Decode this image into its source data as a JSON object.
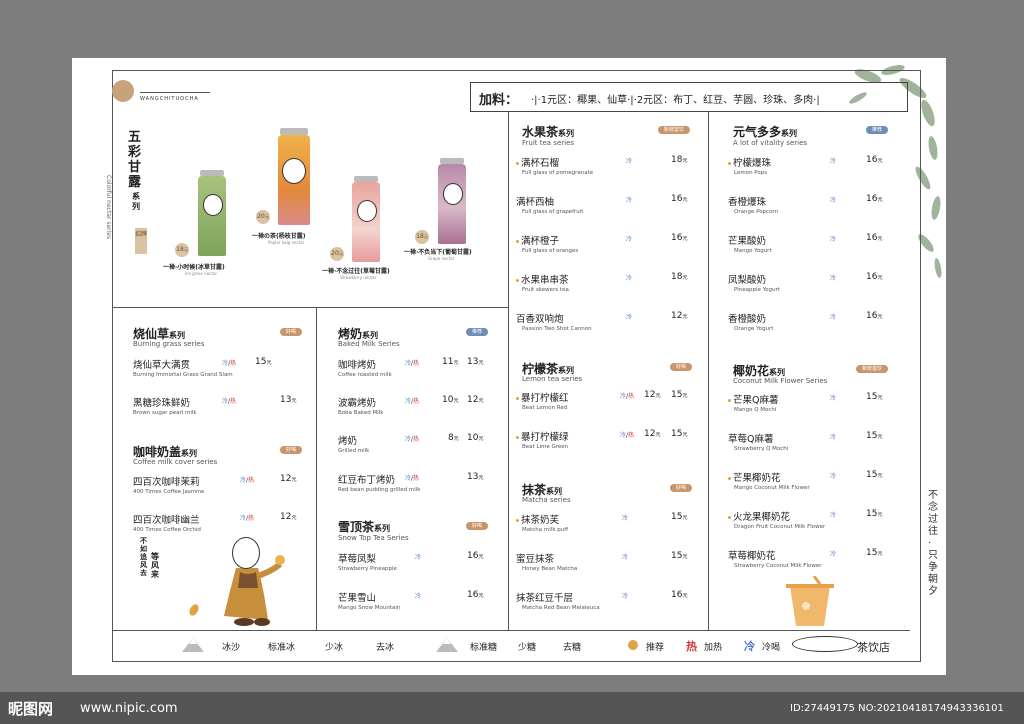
{
  "header": {
    "brand_en": "WANGCHITUOCHA",
    "addons_label": "加料：",
    "addons_text": "·|·1元区：椰果、仙草·|·2元区：布丁、红豆、芋圆、珍珠、多肉·|"
  },
  "nectar": {
    "title": "五彩甘露",
    "title_suffix": "系列",
    "en": "Colorful nectar series",
    "badge": "招牌",
    "products": [
      {
        "name": "一禅·小时候(冰草甘露)",
        "en": "Ice grass nectar",
        "price": "18"
      },
      {
        "name": "一禅の茶(杨枝甘露)",
        "en": "Poplar twig nectar",
        "price": "20"
      },
      {
        "name": "一禅·不念过往(草莓甘露)",
        "en": "Strawberry nectar",
        "price": "20"
      },
      {
        "name": "一禅·不负当下(葡萄甘露)",
        "en": "Grape nectar",
        "price": "18"
      }
    ]
  },
  "grass": {
    "title": "烧仙草",
    "suffix": "系列",
    "en": "Burning grass series",
    "tag": "好喝",
    "items": [
      {
        "name": "烧仙草大满贯",
        "en": "Burning Immortal Grass Grand Slam",
        "price": "15",
        "unit": "元"
      },
      {
        "name": "黑糖珍珠鲜奶",
        "en": "Brown sugar pearl milk",
        "price": "13",
        "unit": "元"
      }
    ]
  },
  "coffee": {
    "title": "咖啡奶盖",
    "suffix": "系列",
    "en": "Coffee milk cover series",
    "tag": "好喝",
    "items": [
      {
        "name": "四百次咖啡茉莉",
        "en": "400 Times Coffee Jasmine",
        "price": "12",
        "unit": "元"
      },
      {
        "name": "四百次咖啡幽兰",
        "en": "400 Times Coffee Orchid",
        "price": "12",
        "unit": "元"
      }
    ],
    "slogan_a": "不如追风去",
    "slogan_b": "等风来"
  },
  "roast": {
    "title": "烤奶",
    "suffix": "系列",
    "en": "Baked Milk Series",
    "tag": "推荐",
    "items": [
      {
        "name": "咖啡烤奶",
        "en": "Coffee roasted milk",
        "m": "11",
        "l": "13"
      },
      {
        "name": "波霸烤奶",
        "en": "Boba Baked Milk",
        "m": "10",
        "l": "12"
      },
      {
        "name": "烤奶",
        "en": "Grilled milk",
        "m": "8",
        "l": "10"
      },
      {
        "name": "红豆布丁烤奶",
        "en": "Red bean pudding grilled milk",
        "m": "",
        "l": "13"
      }
    ]
  },
  "snow": {
    "title": "雪顶茶",
    "suffix": "系列",
    "en": "Snow Top Tea Series",
    "tag": "好喝",
    "items": [
      {
        "name": "草莓凤梨",
        "en": "Strawberry Pineapple",
        "price": "16"
      },
      {
        "name": "芒果雪山",
        "en": "Mango Snow Mountain",
        "price": "16"
      }
    ]
  },
  "fruit": {
    "title": "水果茶",
    "suffix": "系列",
    "en": "Fruit tea series",
    "tag": "新鲜首饮",
    "items": [
      {
        "name": "满杯石榴",
        "en": "Full glass of pomegranate",
        "price": "18",
        "dot": true
      },
      {
        "name": "满杯西柚",
        "en": "Full glass of grapefruit",
        "price": "16",
        "dot": false
      },
      {
        "name": "满杯橙子",
        "en": "Full glass of oranges",
        "price": "16",
        "dot": true
      },
      {
        "name": "水果串串茶",
        "en": "Fruit skewers tea",
        "price": "18",
        "dot": true
      },
      {
        "name": "百香双响炮",
        "en": "Passion Two Shot Cannon",
        "price": "12",
        "dot": false
      }
    ]
  },
  "lemon": {
    "title": "柠檬茶",
    "suffix": "系列",
    "en": "Lemon tea series",
    "tag": "好喝",
    "items": [
      {
        "name": "暴打柠檬红",
        "en": "Beat Lemon Red",
        "m": "12",
        "l": "15",
        "dot": true
      },
      {
        "name": "暴打柠檬绿",
        "en": "Beat Lime Green",
        "m": "12",
        "l": "15",
        "dot": true
      }
    ]
  },
  "matcha": {
    "title": "抹茶",
    "suffix": "系列",
    "en": "Matcha series",
    "tag": "好喝",
    "items": [
      {
        "name": "抹茶奶芙",
        "en": "Matcha milk puff",
        "price": "15",
        "dot": true
      },
      {
        "name": "蜜豆抹茶",
        "en": "Honey Bean Matcha",
        "price": "15",
        "dot": false
      },
      {
        "name": "抹茶红豆千层",
        "en": "Matcha Red Bean Melaleuca",
        "price": "16",
        "dot": false
      }
    ]
  },
  "vitality": {
    "title": "元气多多",
    "suffix": "系列",
    "en": "A lot of vitality series",
    "tag": "推荐",
    "items": [
      {
        "name": "柠檬爆珠",
        "en": "Lemon Pops",
        "price": "16",
        "dot": true
      },
      {
        "name": "香橙爆珠",
        "en": "Orange Popcorn",
        "price": "16",
        "dot": false
      },
      {
        "name": "芒果酸奶",
        "en": "Mango Yogurt",
        "price": "16",
        "dot": false
      },
      {
        "name": "凤梨酸奶",
        "en": "Pineapple Yogurt",
        "price": "16",
        "dot": false
      },
      {
        "name": "香橙酸奶",
        "en": "Orange Yogurt",
        "price": "16",
        "dot": false
      }
    ]
  },
  "coconut": {
    "title": "椰奶花",
    "suffix": "系列",
    "en": "Coconut Milk Flower Series",
    "tag": "新鲜首饮",
    "items": [
      {
        "name": "芒果Q麻薯",
        "en": "Mango Q Mochi",
        "price": "15",
        "dot": true
      },
      {
        "name": "草莓Q麻薯",
        "en": "Strawberry Q Mochi",
        "price": "15",
        "dot": false
      },
      {
        "name": "芒果椰奶花",
        "en": "Mango Coconut Milk Flower",
        "price": "15",
        "dot": true
      },
      {
        "name": "火龙果椰奶花",
        "en": "Dragon Fruit Coconut Milk Flower",
        "price": "15",
        "dot": true
      },
      {
        "name": "草莓椰奶花",
        "en": "Strawberry Coconut Milk Flower",
        "price": "15",
        "dot": false
      }
    ]
  },
  "labels": {
    "cold": "冷",
    "hot": "热",
    "sep": "/",
    "unit": "元"
  },
  "footer": {
    "ice": [
      "冰沙",
      "标准冰",
      "少冰",
      "去冰"
    ],
    "sugar": [
      "标准糖",
      "少糖",
      "去糖"
    ],
    "legend_recommend": "推荐",
    "legend_hot_glyph": "热",
    "legend_hot": "加热",
    "legend_cold_glyph": "冷",
    "legend_cold": "冷喝",
    "shop": "茶饮店"
  },
  "side_slogan": "不念过往·只争朝夕",
  "watermark": {
    "logo": "昵图网",
    "url": "www.nipic.com",
    "id": "ID:27449175 NO:20210418174943336101"
  },
  "colors": {
    "accent": "#e2a243",
    "cold": "#4a79c6",
    "hot": "#d23b3b",
    "tag": "#c9956a"
  }
}
